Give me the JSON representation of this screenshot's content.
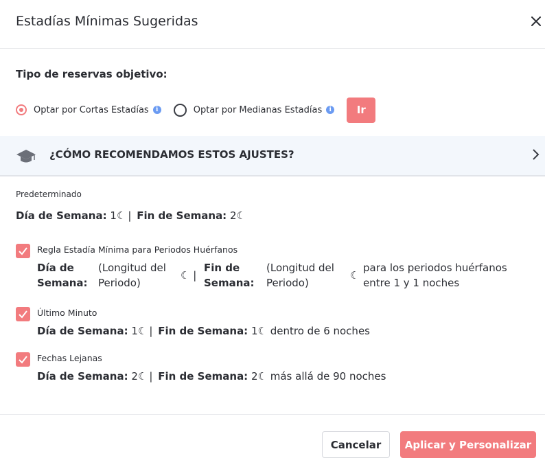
{
  "dialog": {
    "title": "Estadías Mínimas Sugeridas"
  },
  "target": {
    "label": "Tipo de reservas objetivo:",
    "options": [
      {
        "label": "Optar por Cortas Estadías",
        "selected": true
      },
      {
        "label": "Optar por Medianas Estadías",
        "selected": false
      }
    ],
    "go_label": "Ir"
  },
  "accordion": {
    "label": "¿CÓMO RECOMENDAMOS ESTOS AJUSTES?"
  },
  "default": {
    "label": "Predeterminado",
    "weekday_label": "Día de Semana:",
    "weekday_value": "1",
    "weekend_label": "Fin de Semana:",
    "weekend_value": "2"
  },
  "orphan": {
    "label": "Regla Estadía Mínima para Periodos Huérfanos",
    "checked": true,
    "weekday_label": "Día de Semana:",
    "weekday_value": "(Longitud del Periodo)",
    "weekend_label": "Fin de Semana:",
    "weekend_value": "(Longitud del Periodo)",
    "suffix": "para los periodos huérfanos entre 1 y 1 noches"
  },
  "last_minute": {
    "label": "Último Minuto",
    "checked": true,
    "weekday_label": "Día de Semana:",
    "weekday_value": "1",
    "weekend_label": "Fin de Semana:",
    "weekend_value": "1",
    "suffix": "dentro de 6 noches"
  },
  "far_dates": {
    "label": "Fechas Lejanas",
    "checked": true,
    "weekday_label": "Día de Semana:",
    "weekday_value": "2",
    "weekend_label": "Fin de Semana:",
    "weekend_value": "2",
    "suffix": "más allá de 90 noches"
  },
  "footer": {
    "cancel_label": "Cancelar",
    "apply_label": "Aplicar y Personalizar"
  },
  "colors": {
    "accent": "#f27b7e",
    "info": "#6b9bf2",
    "accordion_bg": "#f3f7fc"
  },
  "icons": [
    "close-icon",
    "info-icon",
    "graduation-cap-icon",
    "chevron-right-icon",
    "moon-icon",
    "checkmark-icon"
  ]
}
